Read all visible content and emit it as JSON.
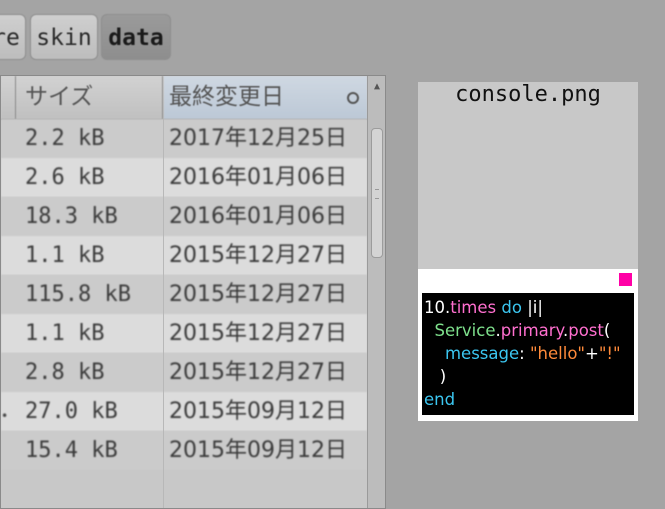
{
  "tabs": [
    {
      "label": "re",
      "active": false
    },
    {
      "label": "skin",
      "active": false
    },
    {
      "label": "data",
      "active": true
    }
  ],
  "table": {
    "columns": {
      "size": "サイズ",
      "modified": "最終変更日"
    },
    "rows": [
      {
        "size": "2.2 kB",
        "modified": "2017年12月25日"
      },
      {
        "size": "2.6 kB",
        "modified": "2016年01月06日"
      },
      {
        "size": "18.3 kB",
        "modified": "2016年01月06日"
      },
      {
        "size": "1.1 kB",
        "modified": "2015年12月27日"
      },
      {
        "size": "115.8 kB",
        "modified": "2015年12月27日"
      },
      {
        "size": "1.1 kB",
        "modified": "2015年12月27日"
      },
      {
        "size": "2.8 kB",
        "modified": "2015年12月27日"
      },
      {
        "size": "27.0 kB",
        "modified": "2015年09月12日"
      },
      {
        "size": "15.4 kB",
        "modified": "2015年09月12日"
      }
    ]
  },
  "preview": {
    "filename": "console.png",
    "code": {
      "l1": {
        "n": "10",
        "dot": ".",
        "times": "times",
        "sp": " ",
        "do": "do",
        "arg": " |i|"
      },
      "l2": {
        "indent": "  ",
        "service": "Service",
        "dot1": ".",
        "primary": "primary",
        "dot2": ".",
        "post": "post",
        "paren": "("
      },
      "l3": {
        "indent": "    ",
        "key": "message",
        "colon": ": ",
        "s1": "\"hello\"",
        "plus": "+",
        "s2": "\"!\""
      },
      "l4": {
        "text": "   )"
      },
      "l5": {
        "text": "end"
      }
    }
  },
  "colors": {
    "accent_pink": "#ff00a6",
    "code_background": "#000000"
  }
}
